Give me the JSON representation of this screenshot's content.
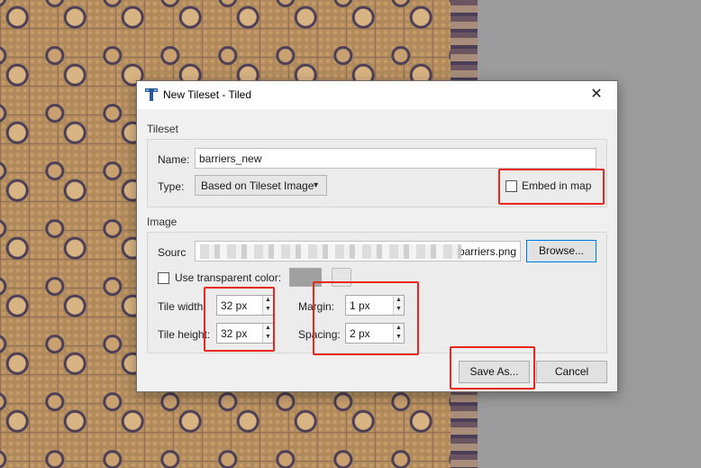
{
  "dialog": {
    "title": "New Tileset - Tiled",
    "close_glyph": "✕"
  },
  "tileset": {
    "group_label": "Tileset",
    "name_label": "Name:",
    "name_value": "barriers_new",
    "type_label": "Type:",
    "type_value": "Based on Tileset Image",
    "embed_label": "Embed in map",
    "embed_checked": false
  },
  "image": {
    "group_label": "Image",
    "source_label": "Sourc",
    "source_value_suffix": "/barriers.png",
    "browse_label": "Browse...",
    "transparent_label": "Use transparent color:",
    "transparent_checked": false,
    "transparent_color": "#a0a0a0",
    "tile_width_label": "Tile width:",
    "tile_width_value": "32 px",
    "tile_height_label": "Tile height:",
    "tile_height_value": "32 px",
    "margin_label": "Margin:",
    "margin_value": "1 px",
    "spacing_label": "Spacing:",
    "spacing_value": "2 px"
  },
  "buttons": {
    "save_as": "Save As...",
    "cancel": "Cancel"
  },
  "icons": [
    "tiled-app-icon",
    "close-icon",
    "chevron-down-icon",
    "spin-up-icon",
    "spin-down-icon"
  ],
  "colors": {
    "highlight": "#e8281e",
    "accent": "#0078d7"
  }
}
